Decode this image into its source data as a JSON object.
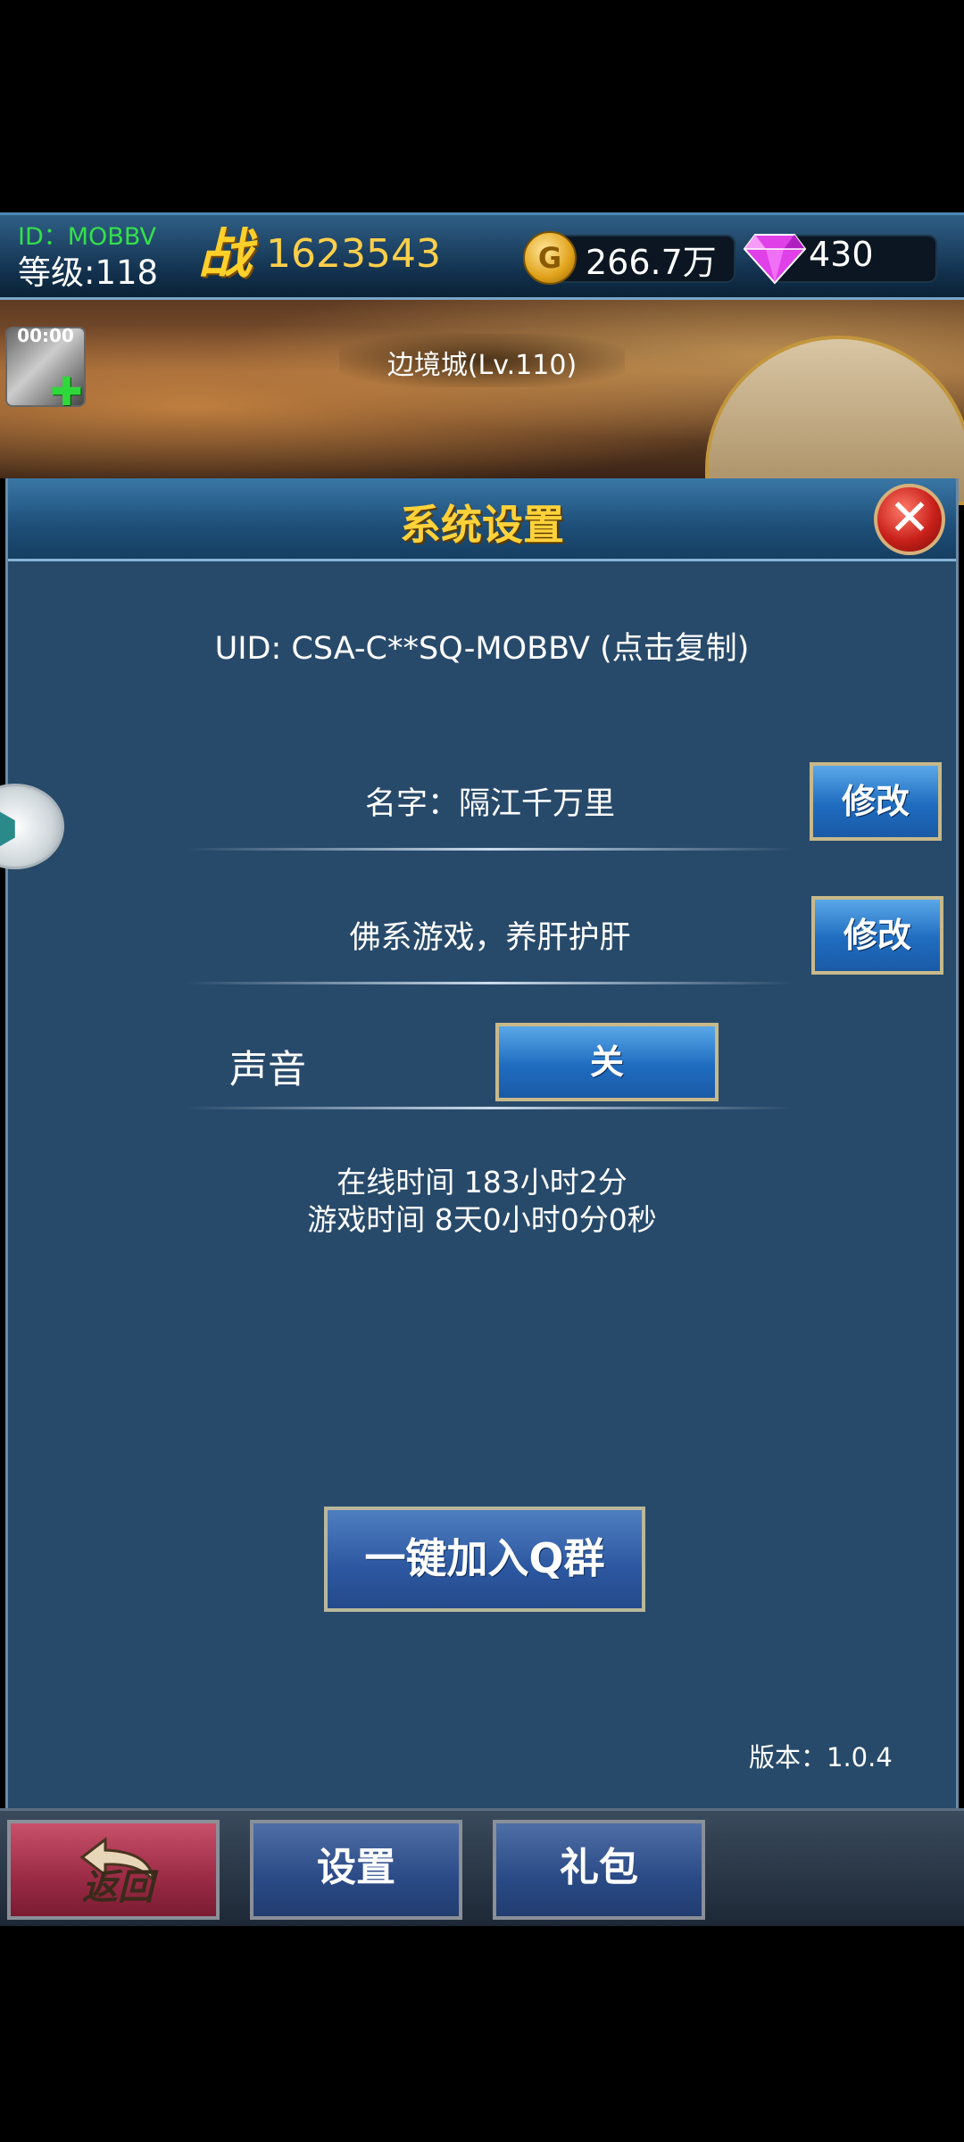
{
  "topbar": {
    "id_text": "ID：MOBBV",
    "level_text": "等级:118",
    "power_label": "战",
    "power_value": "1623543",
    "gold_value": "266.7万",
    "gold_icon_letter": "G",
    "gem_value": "430"
  },
  "banner": {
    "timer": "00:00",
    "city_name": "边境城(Lv.110)"
  },
  "dialog": {
    "title": "系统设置",
    "uid_text": "UID: CSA-C**SQ-MOBBV (点击复制)",
    "name_text": "名字：隔江千万里",
    "name_edit_label": "修改",
    "motto_text": "佛系游戏，养肝护肝",
    "motto_edit_label": "修改",
    "sound_label": "声音",
    "sound_toggle_label": "关",
    "online_time": "在线时间 183小时2分",
    "game_time": "游戏时间 8天0小时0分0秒",
    "join_group_label": "一键加入Q群",
    "version_text": "版本：1.0.4"
  },
  "bottom_nav": {
    "back_label": "返回",
    "settings_label": "设置",
    "gift_label": "礼包"
  },
  "colors": {
    "panel_bg": "#284a6a",
    "title_gold": "#ffd23a",
    "level_green": "#34e04a",
    "button_blue": "#1f6cc0"
  }
}
